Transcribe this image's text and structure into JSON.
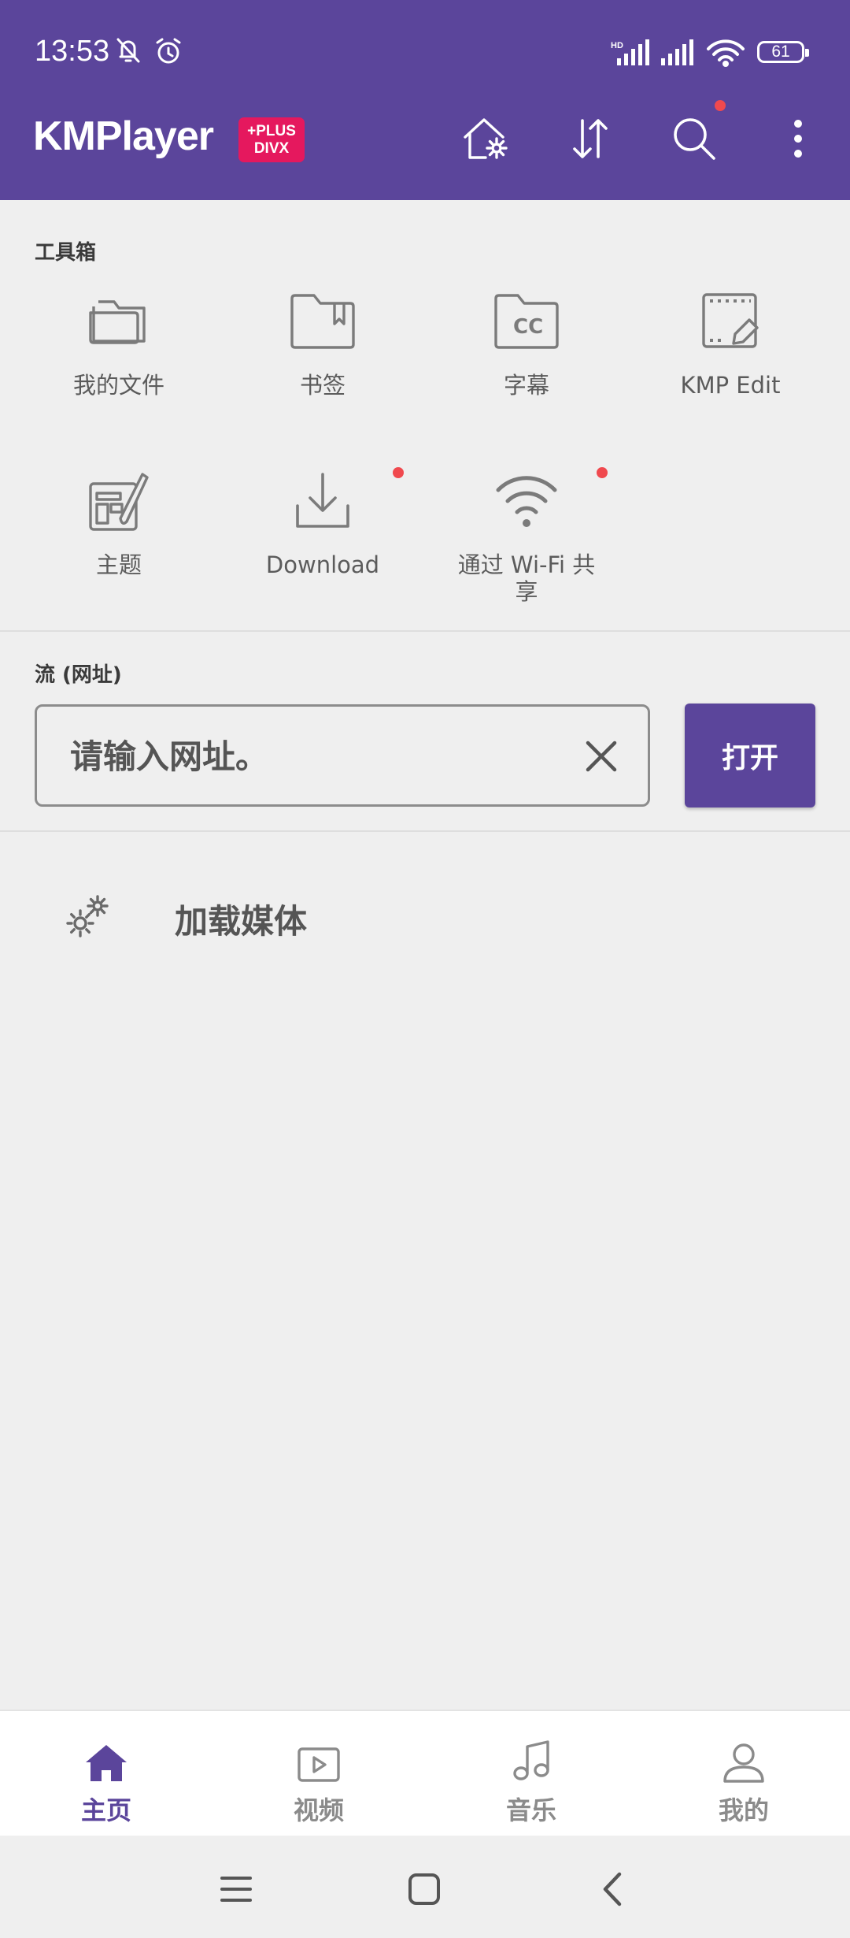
{
  "status": {
    "time": "13:53",
    "battery": "61"
  },
  "header": {
    "brand": "KMPlayer",
    "badge_top": "+PLUS",
    "badge_bottom": "DIVX",
    "accent": "#5b459b",
    "badge_color": "#e5185e"
  },
  "toolbox": {
    "title": "工具箱",
    "items": [
      {
        "label": "我的文件",
        "icon": "folder-icon"
      },
      {
        "label": "书签",
        "icon": "bookmark-folder-icon"
      },
      {
        "label": "字幕",
        "icon": "subtitle-folder-icon"
      },
      {
        "label": "KMP Edit",
        "icon": "edit-frame-icon"
      },
      {
        "label": "主题",
        "icon": "theme-icon"
      },
      {
        "label": "Download",
        "icon": "download-icon"
      },
      {
        "label": "通过 Wi-Fi 共\n享",
        "icon": "wifi-icon"
      }
    ]
  },
  "stream": {
    "title": "流 (网址)",
    "placeholder": "请输入网址。",
    "open_label": "打开"
  },
  "load_media": {
    "label": "加载媒体"
  },
  "bottom_nav": {
    "items": [
      {
        "label": "主页",
        "icon": "home-icon",
        "active": true
      },
      {
        "label": "视频",
        "icon": "video-icon",
        "active": false
      },
      {
        "label": "音乐",
        "icon": "music-icon",
        "active": false
      },
      {
        "label": "我的",
        "icon": "person-icon",
        "active": false
      }
    ]
  }
}
